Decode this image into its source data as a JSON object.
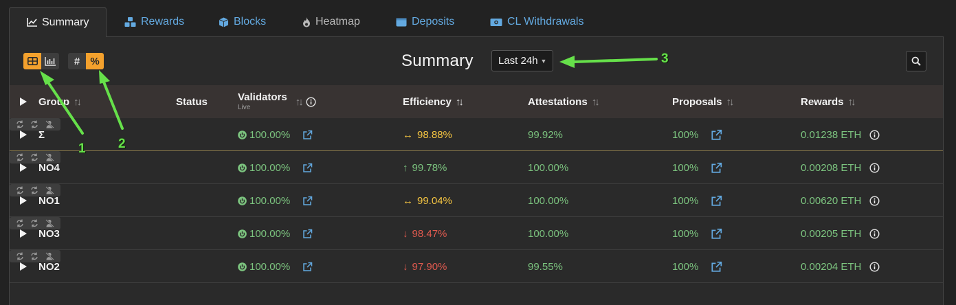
{
  "tabs": [
    {
      "label": "Summary",
      "icon": "line-chart-icon",
      "active": true
    },
    {
      "label": "Rewards",
      "icon": "cubes-icon"
    },
    {
      "label": "Blocks",
      "icon": "cube-icon"
    },
    {
      "label": "Heatmap",
      "icon": "fire-icon"
    },
    {
      "label": "Deposits",
      "icon": "wallet-icon"
    },
    {
      "label": "CL Withdrawals",
      "icon": "money-bill-icon"
    }
  ],
  "toolbar": {
    "view_modes": [
      "table-icon",
      "bar-chart-icon"
    ],
    "value_modes": [
      "#",
      "%"
    ],
    "active_view": "table",
    "active_value": "%"
  },
  "title": "Summary",
  "period": {
    "label": "Last 24h"
  },
  "columns": {
    "group": "Group",
    "status": "Status",
    "validators": "Validators",
    "validators_sub": "Live",
    "efficiency": "Efficiency",
    "attestations": "Attestations",
    "proposals": "Proposals",
    "rewards": "Rewards"
  },
  "rows": [
    {
      "group": "Σ",
      "validators": "100.00%",
      "efficiency": "98.88%",
      "trend": "↔",
      "trend_color": "yellow",
      "attestations": "99.92%",
      "proposals": "100%",
      "rewards": "0.01238 ETH"
    },
    {
      "group": "NO4",
      "validators": "100.00%",
      "efficiency": "99.78%",
      "trend": "↑",
      "trend_color": "green",
      "attestations": "100.00%",
      "proposals": "100%",
      "rewards": "0.00208 ETH"
    },
    {
      "group": "NO1",
      "validators": "100.00%",
      "efficiency": "99.04%",
      "trend": "↔",
      "trend_color": "yellow",
      "attestations": "100.00%",
      "proposals": "100%",
      "rewards": "0.00620 ETH"
    },
    {
      "group": "NO3",
      "validators": "100.00%",
      "efficiency": "98.47%",
      "trend": "↓",
      "trend_color": "red",
      "attestations": "100.00%",
      "proposals": "100%",
      "rewards": "0.00205 ETH"
    },
    {
      "group": "NO2",
      "validators": "100.00%",
      "efficiency": "97.90%",
      "trend": "↓",
      "trend_color": "red",
      "attestations": "99.55%",
      "proposals": "100%",
      "rewards": "0.00204 ETH"
    }
  ],
  "annotations": [
    "1",
    "2",
    "3"
  ],
  "colors": {
    "accent": "#f4a12d",
    "link": "#63a9e0",
    "positive": "#7cc47f",
    "neutral": "#f5c542",
    "negative": "#e05a4f",
    "annotation": "#66e04a"
  }
}
